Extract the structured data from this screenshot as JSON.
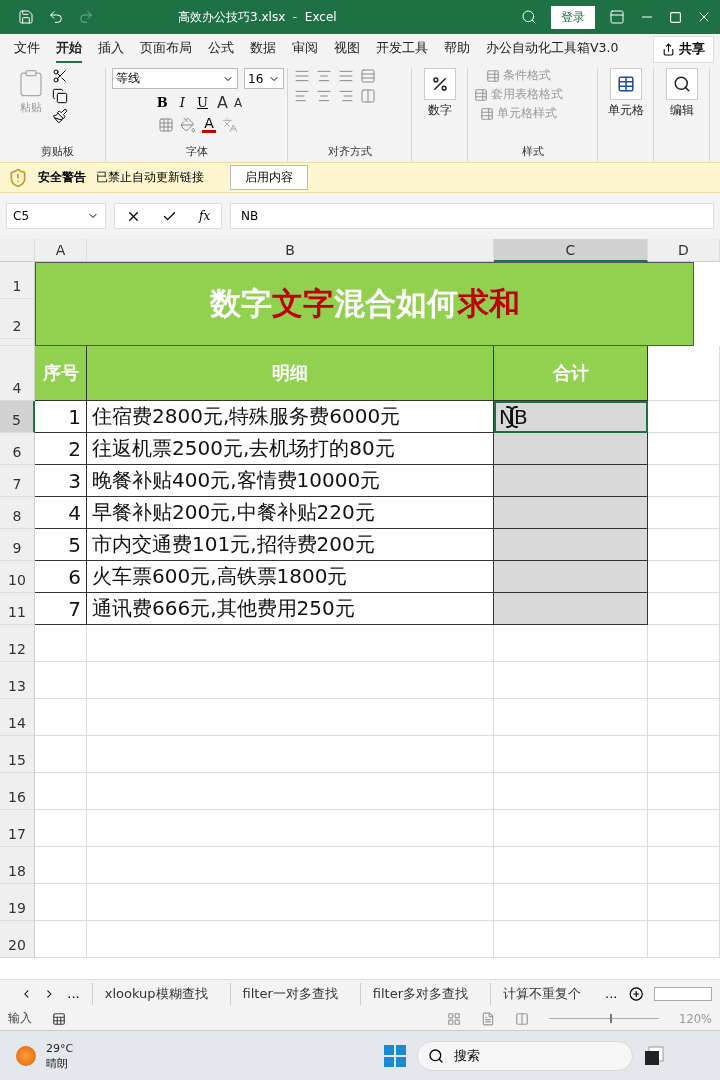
{
  "title_bar": {
    "filename": "高效办公技巧3.xlsx  -  Excel",
    "login": "登录"
  },
  "menu_tabs": [
    {
      "label": "文件",
      "selected": false
    },
    {
      "label": "开始",
      "selected": true
    },
    {
      "label": "插入",
      "selected": false
    },
    {
      "label": "页面布局",
      "selected": false
    },
    {
      "label": "公式",
      "selected": false
    },
    {
      "label": "数据",
      "selected": false
    },
    {
      "label": "审阅",
      "selected": false
    },
    {
      "label": "视图",
      "selected": false
    },
    {
      "label": "开发工具",
      "selected": false
    },
    {
      "label": "帮助",
      "selected": false
    },
    {
      "label": "办公自动化工具箱V3.0",
      "selected": false
    }
  ],
  "share": "共享",
  "ribbon": {
    "paste": "粘贴",
    "font_name": "等线",
    "font_size": "16",
    "format_buttons": [
      "B",
      "I",
      "U"
    ],
    "grow": "A",
    "shrink": "A",
    "font_color": "A",
    "number": "数字",
    "styles": [
      "条件格式",
      "套用表格格式",
      "单元格样式"
    ],
    "cells": "单元格",
    "editing": "编辑",
    "group_labels": [
      "剪贴板",
      "字体",
      "对齐方式",
      "样式"
    ]
  },
  "warning": {
    "title": "安全警告",
    "message": "已禁止自动更新链接",
    "button": "启用内容"
  },
  "formula_bar": {
    "name_box": "C5",
    "fx": "fx",
    "value": "NB"
  },
  "sheet": {
    "columns": [
      {
        "label": "A",
        "selected": false
      },
      {
        "label": "B",
        "selected": false
      },
      {
        "label": "C",
        "selected": true
      },
      {
        "label": "D",
        "selected": false
      }
    ],
    "title_rows": [
      "1",
      "2"
    ],
    "title_segments": [
      {
        "text": "数字",
        "highlight": false
      },
      {
        "text": "文字",
        "highlight": true
      },
      {
        "text": "混合如何",
        "highlight": false
      },
      {
        "text": "求和",
        "highlight": true
      }
    ],
    "header_row": "4",
    "headers": [
      "序号",
      "明细",
      "合计"
    ],
    "rows": [
      {
        "row": "5",
        "index": "1",
        "detail": "住宿费2800元,特殊服务费6000元",
        "total": "NB",
        "selected": true
      },
      {
        "row": "6",
        "index": "2",
        "detail": "往返机票2500元,去机场打的80元",
        "selected": false
      },
      {
        "row": "7",
        "index": "3",
        "detail": "晚餐补贴400元,客情费10000元",
        "selected": false
      },
      {
        "row": "8",
        "index": "4",
        "detail": "早餐补贴200元,中餐补贴220元",
        "selected": false
      },
      {
        "row": "9",
        "index": "5",
        "detail": "市内交通费101元,招待费200元",
        "selected": false
      },
      {
        "row": "10",
        "index": "6",
        "detail": "火车票600元,高铁票1800元",
        "selected": false
      },
      {
        "row": "11",
        "index": "7",
        "detail": "通讯费666元,其他费用250元",
        "selected": false
      }
    ],
    "empty_rows": [
      "12",
      "13",
      "14",
      "15",
      "16",
      "17",
      "18",
      "19",
      "20"
    ]
  },
  "sheet_tabs": {
    "more_left": "...",
    "tabs": [
      "xlookup模糊查找",
      "filter一对多查找",
      "filter多对多查找",
      "计算不重复个"
    ],
    "more_right": "..."
  },
  "status": {
    "mode": "输入",
    "zoom": "120%",
    "zoom_slider": {
      "level": 0.55
    }
  },
  "taskbar": {
    "temperature": "29°C",
    "weather": "晴朗",
    "search": "搜索"
  }
}
